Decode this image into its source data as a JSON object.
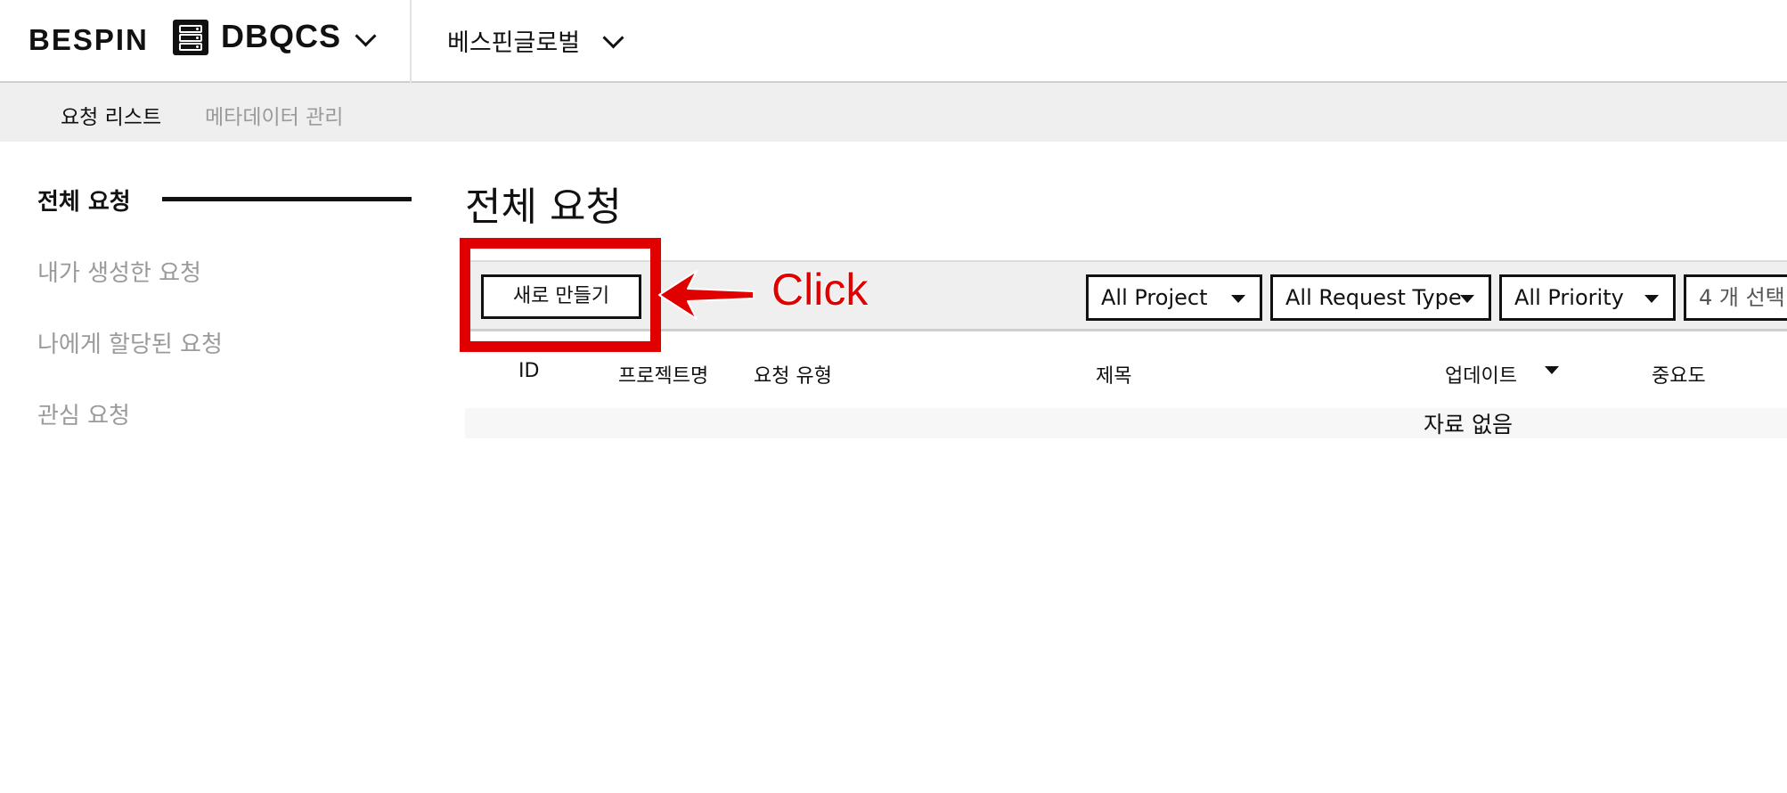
{
  "header": {
    "logo_text": "BESPIN",
    "product_name": "DBQCS",
    "org_name": "베스핀글로벌"
  },
  "subnav": {
    "items": [
      {
        "label": "요청 리스트",
        "active": true
      },
      {
        "label": "메타데이터 관리",
        "active": false
      }
    ]
  },
  "sidebar": {
    "items": [
      {
        "label": "전체 요청",
        "active": true
      },
      {
        "label": "내가 생성한 요청",
        "active": false
      },
      {
        "label": "나에게 할당된 요청",
        "active": false
      },
      {
        "label": "관심 요청",
        "active": false
      }
    ]
  },
  "main": {
    "title": "전체 요청",
    "new_button_label": "새로 만들기",
    "filters": {
      "project": "All Project",
      "request_type": "All Request Type",
      "priority": "All Priority",
      "selection": "4 개 선택"
    },
    "table": {
      "columns": [
        "ID",
        "프로젝트명",
        "요청 유형",
        "제목",
        "업데이트",
        "중요도"
      ],
      "empty_text": "자료 없음"
    }
  },
  "annotation": {
    "label": "Click",
    "color": "#e00000"
  },
  "colors": {
    "subnav_bg": "#efefef",
    "inactive_text": "#9a9a9a",
    "accent": "#111111"
  }
}
